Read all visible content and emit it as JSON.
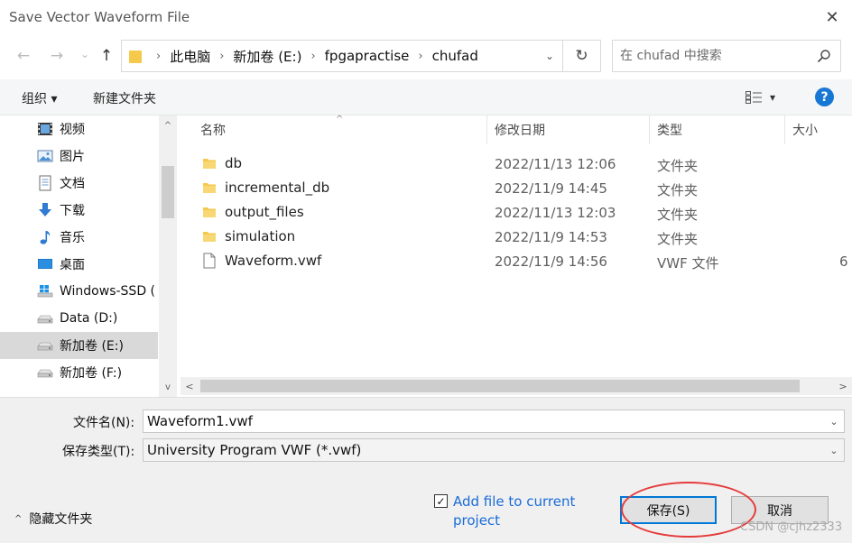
{
  "window": {
    "title": "Save Vector Waveform File",
    "close_glyph": "✕"
  },
  "nav": {
    "back_glyph": "←",
    "forward_glyph": "→",
    "recent_glyph": "⌄",
    "up_glyph": "↑",
    "breadcrumb": [
      "此电脑",
      "新加卷 (E:)",
      "fpgapractise",
      "chufad"
    ],
    "separator": "›",
    "dropdown_glyph": "⌄",
    "refresh_glyph": "↻",
    "search_placeholder": "在 chufad 中搜索"
  },
  "toolbar": {
    "organize_label": "组织 ▾",
    "new_folder_label": "新建文件夹",
    "view_caret": "▾",
    "help_label": "?"
  },
  "sidebar": {
    "items": [
      {
        "label": "视频",
        "icon": "video-icon"
      },
      {
        "label": "图片",
        "icon": "pictures-icon"
      },
      {
        "label": "文档",
        "icon": "documents-icon"
      },
      {
        "label": "下载",
        "icon": "downloads-icon"
      },
      {
        "label": "音乐",
        "icon": "music-icon"
      },
      {
        "label": "桌面",
        "icon": "desktop-icon"
      },
      {
        "label": "Windows-SSD (",
        "icon": "windows-drive-icon"
      },
      {
        "label": "Data (D:)",
        "icon": "drive-icon"
      },
      {
        "label": "新加卷 (E:)",
        "icon": "drive-icon",
        "selected": true
      },
      {
        "label": "新加卷 (F:)",
        "icon": "drive-icon"
      }
    ],
    "scroll_up": "^",
    "scroll_down": "v"
  },
  "file_list": {
    "columns": {
      "name": "名称",
      "date": "修改日期",
      "type": "类型",
      "size": "大小"
    },
    "sort_glyph": "^",
    "rows": [
      {
        "name": "db",
        "date": "2022/11/13 12:06",
        "type": "文件夹",
        "size": "",
        "icon": "folder-icon"
      },
      {
        "name": "incremental_db",
        "date": "2022/11/9 14:45",
        "type": "文件夹",
        "size": "",
        "icon": "folder-icon"
      },
      {
        "name": "output_files",
        "date": "2022/11/13 12:03",
        "type": "文件夹",
        "size": "",
        "icon": "folder-icon"
      },
      {
        "name": "simulation",
        "date": "2022/11/9 14:53",
        "type": "文件夹",
        "size": "",
        "icon": "folder-icon"
      },
      {
        "name": "Waveform.vwf",
        "date": "2022/11/9 14:56",
        "type": "VWF 文件",
        "size": "6",
        "icon": "file-icon"
      }
    ],
    "hscroll_left": "<",
    "hscroll_right": ">"
  },
  "save_form": {
    "filename_label": "文件名(N):",
    "filename_value": "Waveform1.vwf",
    "filetype_label": "保存类型(T):",
    "filetype_value": "University Program VWF (*.vwf)",
    "dropdown_glyph": "⌄",
    "hide_folders_label": "隐藏文件夹",
    "hide_caret": "^",
    "add_file_label": "Add file to current project",
    "add_file_checked": "✓",
    "save_label": "保存(S)",
    "cancel_label": "取消"
  },
  "watermark": "CSDN @cjhz2333",
  "colors": {
    "accent": "#0078d7",
    "folder": "#f4c94c",
    "link": "#1a6cd8",
    "annotation": "#e53b3b"
  }
}
